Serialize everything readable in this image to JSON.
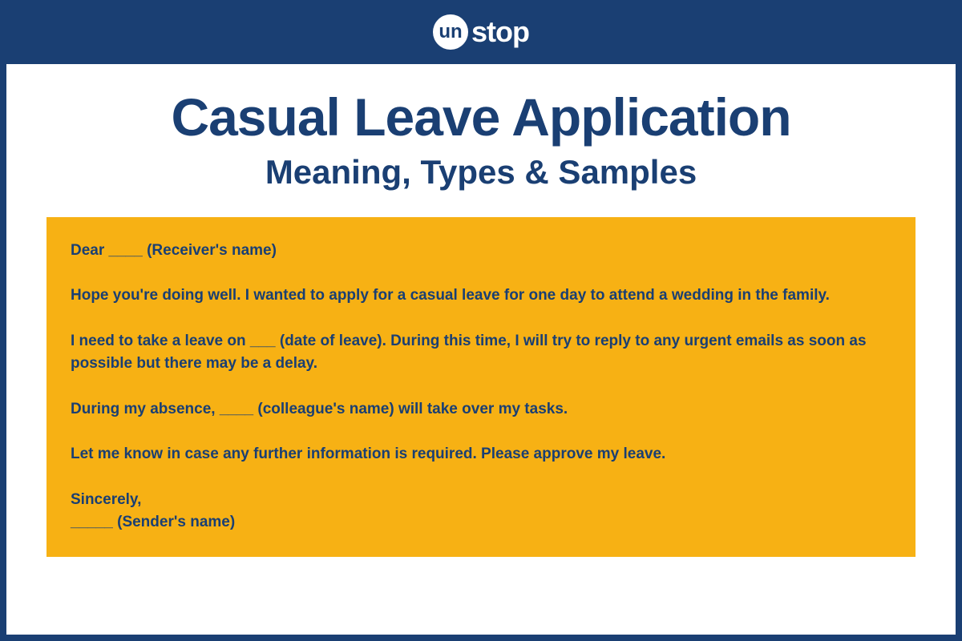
{
  "logo": {
    "circle_text": "un",
    "text": "stop"
  },
  "titles": {
    "main": "Casual Leave Application",
    "sub": "Meaning, Types & Samples"
  },
  "letter": {
    "greeting": "Dear ____ (Receiver's name)",
    "para1": "Hope you're doing well. I wanted to apply for a casual leave for one day to attend a wedding in the family.",
    "para2": "I need to take a leave on ___ (date of leave). During this time, I will try to reply to any urgent emails as soon as possible but there may be a delay.",
    "para3": "During my absence, ____ (colleague's name) will take over my tasks.",
    "para4": "Let me know in case any further information is required. Please approve my leave.",
    "closing": "Sincerely,",
    "sender": "_____ (Sender's name)"
  }
}
